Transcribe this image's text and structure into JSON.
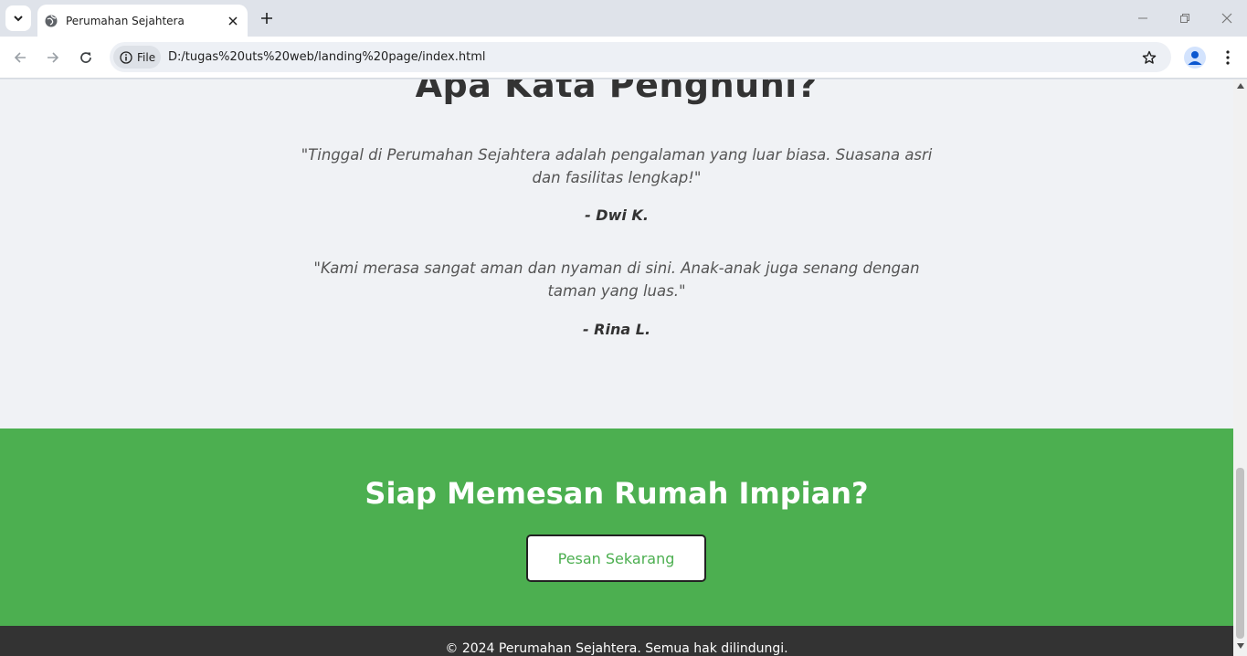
{
  "browser": {
    "tab_title": "Perumahan Sejahtera",
    "chip_label": "File",
    "url": "D:/tugas%20uts%20web/landing%20page/index.html"
  },
  "testimonials": {
    "title": "Apa Kata Penghuni?",
    "items": [
      {
        "quote": "\"Tinggal di Perumahan Sejahtera adalah pengalaman yang luar biasa. Suasana asri dan fasilitas lengkap!\"",
        "author": "- Dwi K."
      },
      {
        "quote": "\"Kami merasa sangat aman dan nyaman di sini. Anak-anak juga senang dengan taman yang luas.\"",
        "author": "- Rina L."
      }
    ]
  },
  "cta": {
    "title": "Siap Memesan Rumah Impian?",
    "button_label": "Pesan Sekarang"
  },
  "footer": {
    "text": "© 2024 Perumahan Sejahtera. Semua hak dilindungi."
  },
  "colors": {
    "cta_green": "#4caf50",
    "footer_dark": "#333333",
    "page_bg": "#f0f2f5"
  }
}
